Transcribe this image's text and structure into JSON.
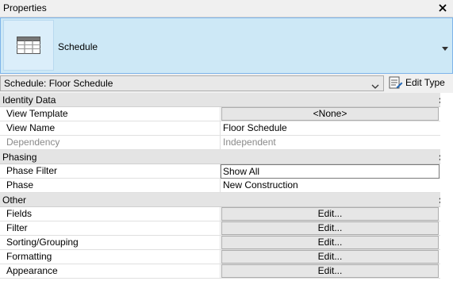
{
  "window": {
    "title": "Properties"
  },
  "type_selector": {
    "name": "Schedule",
    "icon": "schedule-table-icon"
  },
  "view_selector": {
    "value": "Schedule: Floor Schedule"
  },
  "edit_type": {
    "label": "Edit Type",
    "icon": "edit-type-icon"
  },
  "groups": {
    "identity": {
      "label": "Identity Data",
      "rows": {
        "view_template": {
          "name": "View Template",
          "value": "<None>"
        },
        "view_name": {
          "name": "View Name",
          "value": "Floor Schedule"
        },
        "dependency": {
          "name": "Dependency",
          "value": "Independent"
        }
      }
    },
    "phasing": {
      "label": "Phasing",
      "rows": {
        "phase_filter": {
          "name": "Phase Filter",
          "value": "Show All"
        },
        "phase": {
          "name": "Phase",
          "value": "New Construction"
        }
      }
    },
    "other": {
      "label": "Other",
      "rows": {
        "fields": {
          "name": "Fields",
          "value": "Edit..."
        },
        "filter": {
          "name": "Filter",
          "value": "Edit..."
        },
        "sorting": {
          "name": "Sorting/Grouping",
          "value": "Edit..."
        },
        "formatting": {
          "name": "Formatting",
          "value": "Edit..."
        },
        "appearance": {
          "name": "Appearance",
          "value": "Edit..."
        }
      }
    }
  },
  "colors": {
    "selection_bg": "#cde8f6",
    "selection_border": "#7eb4ea",
    "group_bg": "#e4e4e4"
  }
}
